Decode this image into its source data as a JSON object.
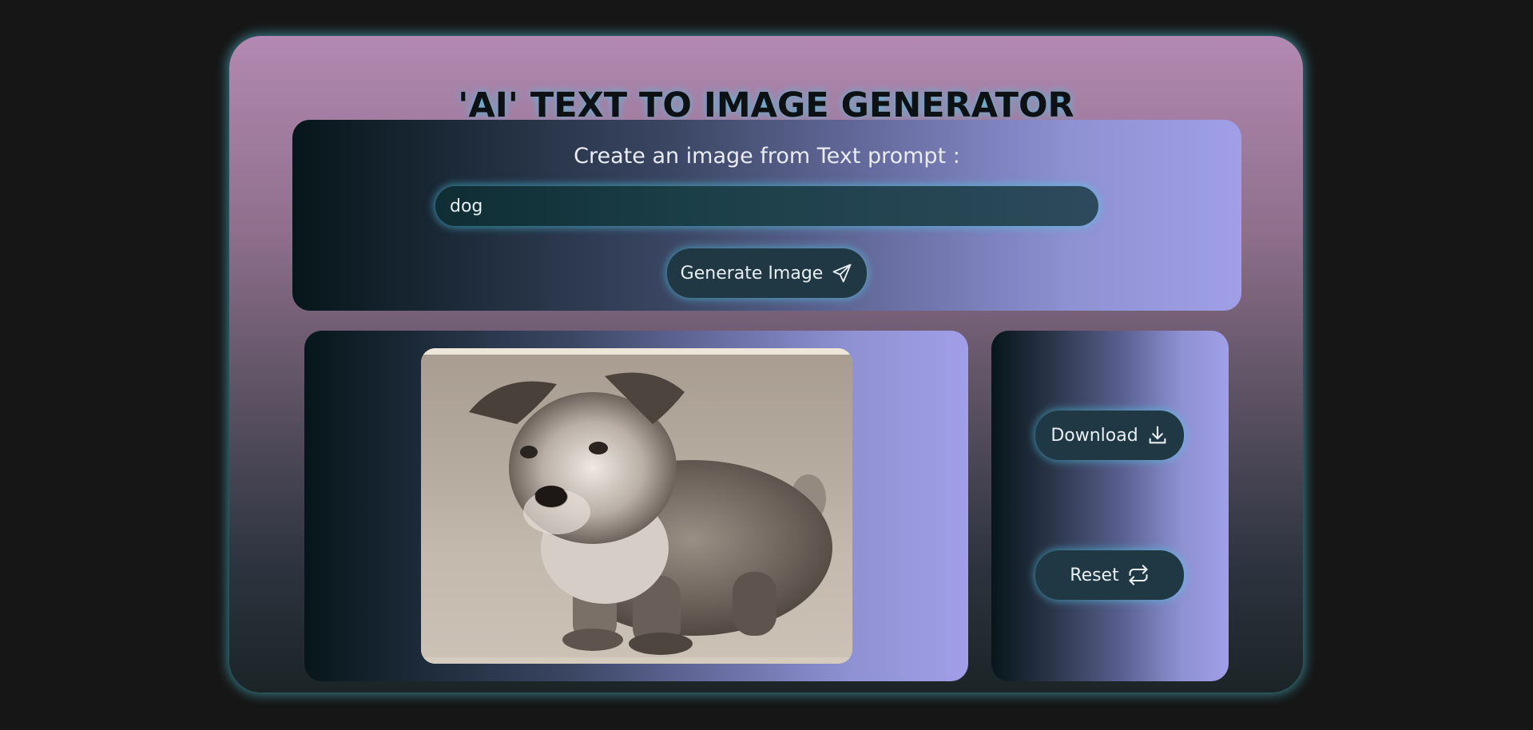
{
  "app": {
    "title": "'AI' TEXT TO IMAGE GENERATOR"
  },
  "prompt": {
    "label": "Create an image from Text prompt :",
    "value": "dog",
    "generate_label": "Generate Image",
    "generate_icon": "send-icon"
  },
  "result": {
    "image_alt": "generated-dog-image"
  },
  "actions": {
    "download_label": "Download",
    "download_icon": "download-icon",
    "reset_label": "Reset",
    "reset_icon": "repeat-icon"
  },
  "colors": {
    "background": "#161616",
    "card_glow": "#50c8dc",
    "button_bg": "#203843",
    "title_text": "#0d1114"
  }
}
